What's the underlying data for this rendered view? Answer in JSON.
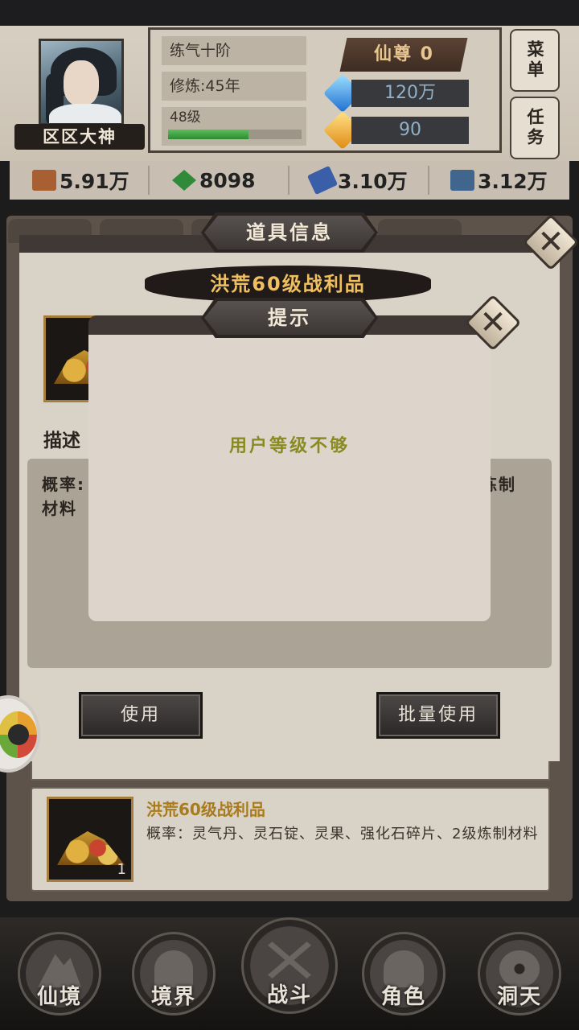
{
  "player": {
    "name": "区区大神",
    "realm": "练气十阶",
    "cultivation": "修炼:45年",
    "level": "48级",
    "exp_fraction": 0.6,
    "rank_title": "仙尊  0",
    "blue_gems": "120万",
    "gold_gems": "90"
  },
  "side_menu": {
    "menu_label": "菜单",
    "task_label": "任务"
  },
  "resources": [
    {
      "icon": "ore-icon",
      "value": "5.91万"
    },
    {
      "icon": "herb-icon",
      "value": "8098"
    },
    {
      "icon": "spirit-stone-icon",
      "value": "3.10万"
    },
    {
      "icon": "iron-icon",
      "value": "3.12万"
    }
  ],
  "item_dialog": {
    "banner": "道具信息",
    "item_name": "洪荒60级战利品",
    "desc_label": "描述",
    "desc_visible_left_1": "概率:",
    "desc_visible_left_2": "材料",
    "desc_visible_right": "炼制",
    "use_button": "使用",
    "bulk_use_button": "批量使用"
  },
  "alert_dialog": {
    "banner": "提示",
    "message": "用户等级不够"
  },
  "bag_item": {
    "title": "洪荒60级战利品",
    "description": "概率：灵气丹、灵石锭、灵果、强化石碎片、2级炼制材料",
    "count": "1"
  },
  "bottom_nav": [
    {
      "label": "仙境",
      "icon": "mountain-icon"
    },
    {
      "label": "境界",
      "icon": "meditation-icon"
    },
    {
      "label": "战斗",
      "icon": "crossed-swords-icon"
    },
    {
      "label": "角色",
      "icon": "character-icon"
    },
    {
      "label": "洞天",
      "icon": "cave-icon"
    }
  ],
  "colors": {
    "accent_gold": "#f0c060",
    "alert_text": "#8a8a22",
    "panel_dark": "#3f3834"
  }
}
